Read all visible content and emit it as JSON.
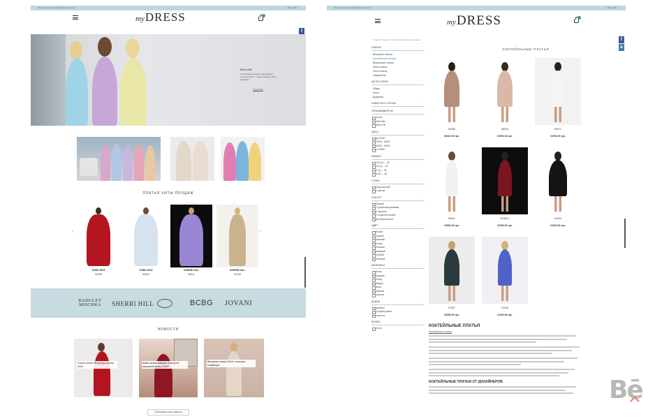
{
  "brand": {
    "logo_script": "my",
    "logo_word": "DRESS"
  },
  "left": {
    "topbar_left": "Шоу-Коллекции     Магазин     Контакты",
    "topbar_right": "⌕     Вход / Рег",
    "hero": {
      "title": "Sherri Hill",
      "text": "Коллекция вечерних и выпускных платьев 2018 — новые модели уже в магазине.",
      "link": "подробнее"
    },
    "bestsellers_title": "ПЛАТЬЯ ХИТЫ ПРОДАЖ",
    "products": [
      {
        "name": "TARIK EDIZ",
        "price": "92436"
      },
      {
        "name": "TARIK EDIZ",
        "price": "90403"
      },
      {
        "name": "SHERRI HILL",
        "price": "52011"
      },
      {
        "name": "SHERRI HILL",
        "price": "51148"
      }
    ],
    "brands": [
      "BADGLEY MISCHKA",
      "SHERRI HILL",
      "",
      "BCBG",
      "JOVANI"
    ],
    "news_title": "НОВОСТИ",
    "news": [
      {
        "title": "Платья Sherri Hill spring summer 2018"
      },
      {
        "title": "Какие лучше выбрать платья на выпускной вечер 2018?"
      },
      {
        "title": "Вечерние платья 2018: стильные тенденции"
      }
    ],
    "news_button": "Посмотреть все новости"
  },
  "right": {
    "topbar_left": "Шоу-Коллекции     Магазин     Контакты",
    "topbar_right": "⌕     Вход / Рег",
    "breadcrumb": "Главная  /  Каталог  /  Платья  /  Коктейльные платья",
    "page_title": "КОКТЕЙЛЬНЫЕ ПЛАТЬЯ",
    "sidebar": [
      {
        "heading": "ПЛАТЬЯ",
        "items": [
          "Вечерние платья",
          "Коктейльные платья",
          "Выпускные платья",
          "Мини-платья",
          "Элит-платья",
          "Свадебные"
        ],
        "selected": 1
      },
      {
        "heading": "АКСЕССУАРЫ",
        "items": [
          "Обувь",
          "Клатч",
          "Диадемы"
        ]
      },
      {
        "heading": "НОВОСТИ И СТАТЬИ",
        "items": []
      },
      {
        "heading": "ПРОИЗВОДИТЕЛЬ",
        "checks": [
          "Jovani",
          "Tarik Ediz",
          "Sherri Hill"
        ]
      },
      {
        "heading": "ЦЕНА",
        "checks": [
          "до 10000",
          "10000 - 15000",
          "15000 - 20000",
          "от 20000"
        ]
      },
      {
        "heading": "РАЗМЕР",
        "checks": [
          "XXS (0) — 32",
          "XS (2) — 34",
          "S (4) — 36",
          "M (6) — 38"
        ]
      },
      {
        "heading": "СТИЛЬ",
        "checks": [
          "Классический",
          "С цветой"
        ]
      },
      {
        "heading": "СИЛУЭТ",
        "checks": [
          "Прямой",
          "С длинными рукавами",
          "С запахом",
          "С открытой спиной",
          "Для беременных"
        ]
      },
      {
        "heading": "ЦВЕТ",
        "checks": [
          "Белый",
          "Черный",
          "Красный",
          "Синий",
          "Розовый",
          "Бежевый",
          "Голубой",
          "Зеленый"
        ]
      },
      {
        "heading": "МАТЕРИАЛ",
        "checks": [
          "Атлас",
          "Кружево",
          "Гипюр",
          "Шифон",
          "Шелк",
          "Пайетки",
          "Органза"
        ]
      },
      {
        "heading": "ДЛИНА",
        "checks": [
          "Длинное",
          "Средней длины",
          "Короткое"
        ]
      },
      {
        "heading": "ВОЗМО",
        "checks": [
          "Лента"
        ]
      }
    ],
    "products": [
      {
        "code": "63085",
        "price": "53610.00 грн."
      },
      {
        "code": "66026",
        "price": "15000.00 грн."
      },
      {
        "code": "50671",
        "price": "15750.00 грн."
      },
      {
        "code": "50691",
        "price": "15950.00 грн."
      },
      {
        "code": "51048-1",
        "price": "23350.00 грн."
      },
      {
        "code": "50494",
        "price": "13320.00 грн."
      },
      {
        "code": "51037",
        "price": "15950.00 грн."
      },
      {
        "code": "51108",
        "price": "14400.00 грн."
      }
    ],
    "text_title": "КОКТЕЙЛЬНЫЕ ПЛАТЬЯ",
    "text_subtitle": "Коктейльные платья",
    "text_title2": "КОКТЕЙЛЬНЫЕ ПЛАТЬЯ ОТ ДИЗАЙНЕРОВ"
  },
  "watermark": "Bē"
}
